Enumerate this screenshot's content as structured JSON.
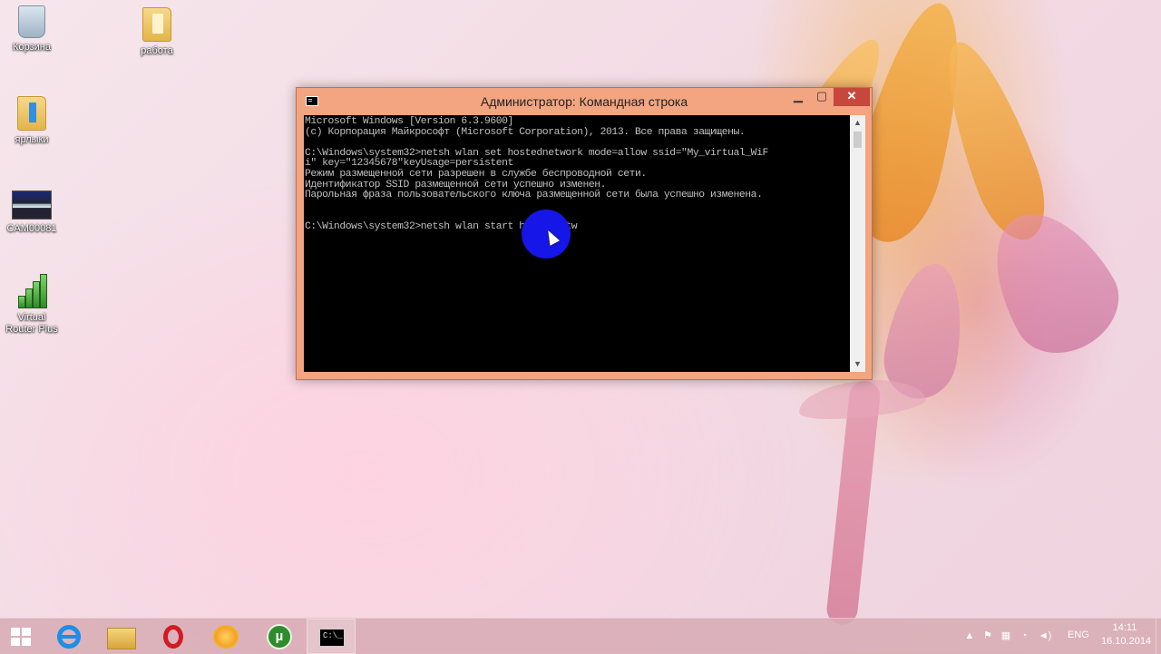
{
  "desktop": {
    "icons": [
      {
        "label": "Корзина",
        "icon": "recycle-bin-icon"
      },
      {
        "label": "работа",
        "icon": "folder-icon"
      },
      {
        "label": "ярлыки",
        "icon": "folder-shortcuts-icon"
      },
      {
        "label": "CAM00081",
        "icon": "image-thumbnail-icon"
      },
      {
        "label": "Virtual Router Plus",
        "icon": "virtual-router-icon"
      }
    ]
  },
  "window": {
    "title": "Администратор: Командная строка",
    "minimize_label": "▁",
    "maximize_label": "▢",
    "close_label": "✕",
    "console_lines": [
      "Microsoft Windows [Version 6.3.9600]",
      "(c) Корпорация Майкрософт (Microsoft Corporation), 2013. Все права защищены.",
      "",
      "C:\\Windows\\system32>netsh wlan set hostednetwork mode=allow ssid=\"My_virtual_WiF",
      "i\" key=\"12345678\"keyUsage=persistent",
      "Режим размещенной сети разрешен в службе беспроводной сети.",
      "Идентификатор SSID размещенной сети успешно изменен.",
      "Парольная фраза пользовательского ключа размещенной сети была успешно изменена.",
      "",
      "",
      "C:\\Windows\\system32>netsh wlan start hostednetw"
    ],
    "scroll_up": "▲",
    "scroll_down": "▼"
  },
  "taskbar": {
    "apps": [
      {
        "name": "start",
        "icon": "windows-logo-icon"
      },
      {
        "name": "internet-explorer",
        "icon": "internet-explorer-icon"
      },
      {
        "name": "file-explorer",
        "icon": "file-explorer-icon"
      },
      {
        "name": "opera",
        "icon": "opera-icon"
      },
      {
        "name": "app-orange",
        "icon": "orange-sun-icon"
      },
      {
        "name": "utorrent",
        "icon": "utorrent-icon",
        "glyph": "µ"
      },
      {
        "name": "command-prompt",
        "icon": "cmd-icon",
        "glyph": "C:\\_",
        "active": true
      }
    ],
    "tray": {
      "chevron": "▲",
      "flag": "⚑",
      "network": "▦",
      "wifi": "◔",
      "volume": "◄)",
      "language": "ENG",
      "time": "14:11",
      "date": "16.10.2014"
    }
  },
  "colors": {
    "window_frame": "#f2a580",
    "close_button": "#c7473d",
    "console_bg": "#000000",
    "console_text": "#c0c0c0",
    "cursor_highlight": "#1616e8"
  }
}
